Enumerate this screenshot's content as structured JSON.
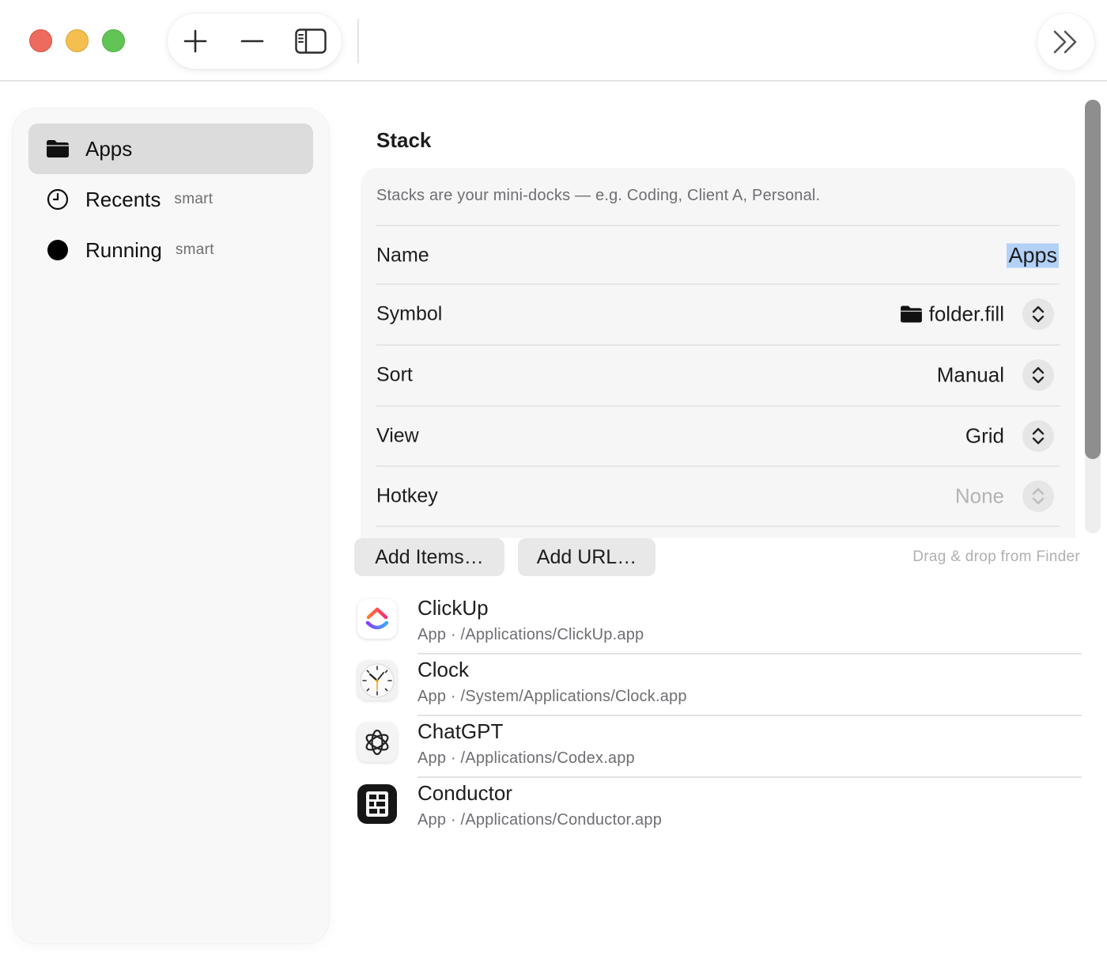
{
  "sidebar": {
    "items": [
      {
        "label": "Apps",
        "tag": "",
        "icon": "folder-icon",
        "selected": true
      },
      {
        "label": "Recents",
        "tag": "smart",
        "icon": "clock-icon",
        "selected": false
      },
      {
        "label": "Running",
        "tag": "smart",
        "icon": "filled-circle-icon",
        "selected": false
      }
    ]
  },
  "stack": {
    "title": "Stack",
    "description": "Stacks are your mini-docks — e.g. Coding, Client A, Personal.",
    "name": {
      "label": "Name",
      "value": "Apps"
    },
    "symbol": {
      "label": "Symbol",
      "value": "folder.fill"
    },
    "sort": {
      "label": "Sort",
      "value": "Manual"
    },
    "view": {
      "label": "View",
      "value": "Grid"
    },
    "hotkey": {
      "label": "Hotkey",
      "value": "None"
    }
  },
  "actions": {
    "add_items": "Add Items…",
    "add_url": "Add URL…",
    "drag_hint": "Drag & drop from Finder"
  },
  "apps": [
    {
      "name": "ClickUp",
      "path": "App · /Applications/ClickUp.app",
      "icon": "clickup-icon"
    },
    {
      "name": "Clock",
      "path": "App · /System/Applications/Clock.app",
      "icon": "clock-app-icon"
    },
    {
      "name": "ChatGPT",
      "path": "App · /Applications/Codex.app",
      "icon": "chatgpt-icon"
    },
    {
      "name": "Conductor",
      "path": "App · /Applications/Conductor.app",
      "icon": "conductor-icon"
    }
  ],
  "colors": {
    "selection": "#b3d1f7",
    "sidebar_selected": "#dcdcdc",
    "close": "#ed6a5e",
    "minimize": "#f5bf4f",
    "maximize": "#61c454"
  }
}
